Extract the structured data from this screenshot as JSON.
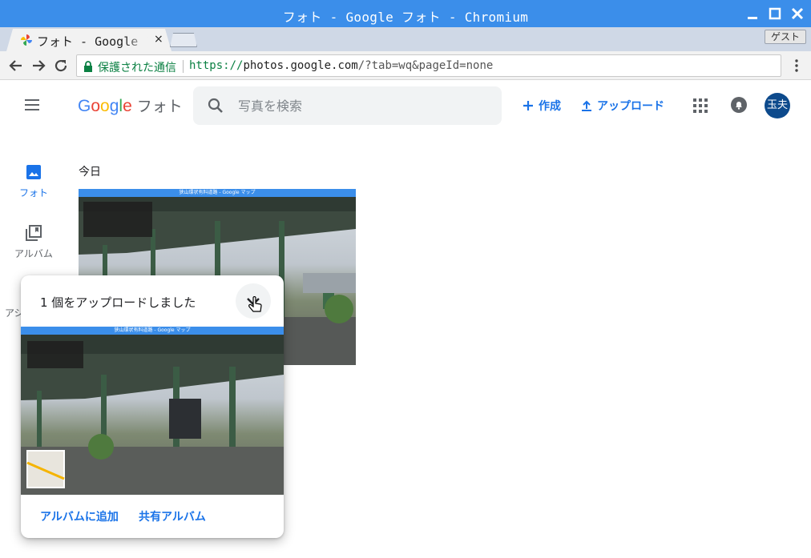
{
  "window": {
    "title": "フォト - Google フォト - Chromium"
  },
  "tab": {
    "title": "フォト - Google フォト",
    "close_glyph": "×"
  },
  "guest": "ゲスト",
  "address": {
    "security_label": "保護された通信",
    "scheme": "https://",
    "host": "photos.google.com",
    "path": "/?tab=wq&pageId=none"
  },
  "header": {
    "logo_letters": [
      "G",
      "o",
      "o",
      "g",
      "l",
      "e"
    ],
    "product": "フォト",
    "search_placeholder": "写真を検索",
    "create_label": "作成",
    "upload_label": "アップロード",
    "avatar_text": "玉夫"
  },
  "sidebar": {
    "photos_label": "フォト",
    "albums_label": "アルバム",
    "assistant_label": "アシ"
  },
  "main": {
    "date_label": "今日"
  },
  "screenshot": {
    "window_title": "狭山環状有料道路 - Google マップ"
  },
  "toast": {
    "message": "1 個をアップロードしました",
    "add_to_album": "アルバムに追加",
    "shared_album": "共有アルバム"
  },
  "colors": {
    "titlebar": "#3b8eea",
    "accent": "#1a73e8",
    "secure": "#0b8043",
    "avatar_bg": "#0d4a8c"
  }
}
